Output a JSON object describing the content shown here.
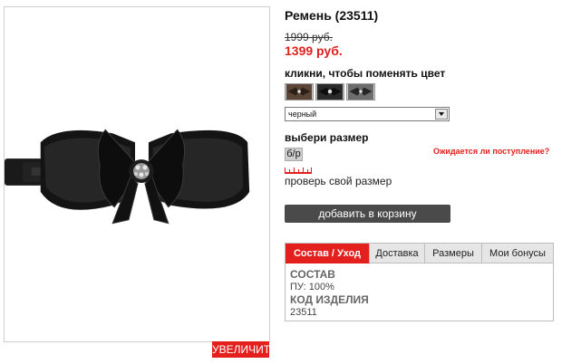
{
  "product": {
    "title": "Ремень (23511)",
    "old_price": "1999 руб.",
    "new_price": "1399 руб.",
    "image_icon": "fur-belt-with-bow-photo"
  },
  "image": {
    "zoom_label": "УВЕЛИЧИТЬ"
  },
  "color": {
    "label": "кликни, чтобы поменять цвет",
    "swatches": [
      "brown-swatch",
      "black-swatch",
      "dark-gray-swatch"
    ],
    "selected": "черный"
  },
  "size": {
    "label": "выбери размер",
    "options": [
      "б/р"
    ],
    "restock_link": "Ожидается ли поступление?",
    "check_link": "проверь свой размер",
    "ruler_icon": "ruler-icon"
  },
  "cart": {
    "button_label": "добавить в корзину"
  },
  "tabs": {
    "items": [
      {
        "label": "Состав / Уход",
        "active": true
      },
      {
        "label": "Доставка",
        "active": false
      },
      {
        "label": "Размеры",
        "active": false
      },
      {
        "label": "Мои бонусы",
        "active": false
      }
    ],
    "content": {
      "composition_title": "СОСТАВ",
      "composition_value": "ПУ: 100%",
      "code_title": "КОД ИЗДЕЛИЯ",
      "code_value": "23511"
    }
  },
  "colors": {
    "accent_red": "#e4201e",
    "button_dark": "#4a4a4a",
    "tab_gray": "#e6e6e6"
  }
}
